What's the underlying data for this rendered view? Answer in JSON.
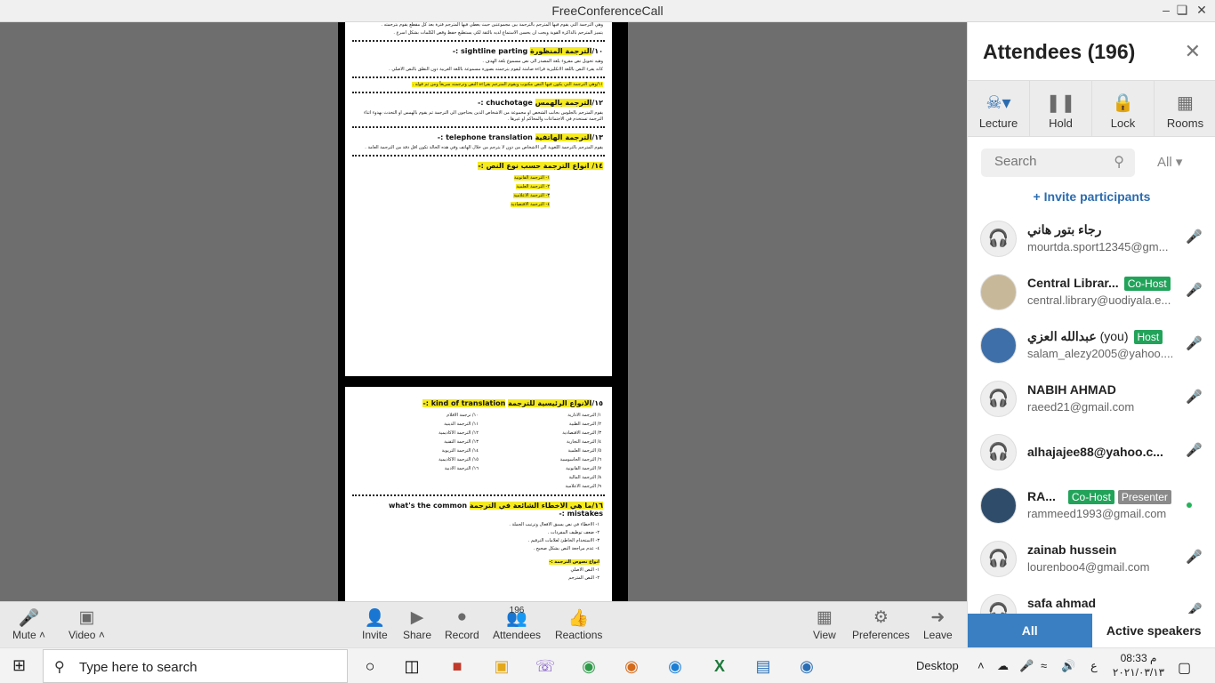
{
  "window": {
    "title": "FreeConferenceCall"
  },
  "document": {
    "page1": {
      "top_para_1": "وهي الترجمة التي يقوم فيها المترجم بالترجمة بين مجموعتين حيث يعطي فيها المترجم فترة بعد كل مقطع يقوم بترجمته .",
      "top_para_2": "يتميز المترجم بالذاكرة القوية ويجب ان يحسن الاستماع لديه بالثقة لكي يستطيع حفظ وقص الكلمات بشكل اسرع .",
      "h10_num": "١٠/",
      "h10_ar": "الترجمة المنظورة",
      "h10_en": "sightline parting :-",
      "p10_1": "وهيه تحويل نص مقروء بلغة المصدر الى نص مسموع بلغة الهدف .",
      "p10_2": "كانه يقرء النص باللغة الانكليزية قراءة صامتة ليقوم بترجمته بصورة مسموعة باللغة العربية دون النطق بالنص الاصلي .",
      "p11": "١١/وهي الترجمة التي يكون فيها النص مكتوب ويقوم المترجم بقراءة النص وترجمته سريعاً ومن ثم قوله .",
      "h12_num": "١٢/",
      "h12_ar": "الترجمة بالهمس",
      "h12_en": "chuchotage :-",
      "p12": "يقوم المترجم بالجلوس بجانب الشخص او مجموعة من الاشخاص الذين يحتاجون الى الترجمة ثم يقوم بالهمس او التحدث بهدوء اثناء الترجمة تستخدم في الاجتماعات والمحاكم او غيرها .",
      "h13_num": "١٣/",
      "h13_ar": "الترجمة الهاتفية",
      "h13_en": "telephone translation :-",
      "p13": "يقوم المترجم بالترجمة اللغوية الى الاشخاص من دون لا يترجم من خلال الهاتف وفي هذه الحالة تكون اقل دقة من الترجمة العامة .",
      "h14": "١٤/ انواع الترجمة حسب نوع النص :-",
      "list14": [
        "١- الترجمة القانونية",
        "٢- الترجمة العلمية",
        "٣- الترجمة الاعلامية",
        "٤- الترجمة الاقتصادية"
      ]
    },
    "page2": {
      "h15_num": "١٥/",
      "h15_ar": "الانواع الرئيسية للترجمة",
      "h15_en": "kind of translation :-",
      "col_right": [
        "١/ الترجمة الادارية",
        "٢/ الترجمة الطبية",
        "٣/ الترجمة الاقتصادية",
        "٤/ الترجمة التجارية",
        "٥/ الترجمة العلمية",
        "٦/ الترجمة الجاسوسية",
        "٧/ الترجمة القانونية",
        "٨/ الترجمة المالية",
        "٩/ الترجمة الاعلامية"
      ],
      "col_left": [
        "١٠/ ترجمة الافلام",
        "١١/ الترجمة الدينية",
        "١٢/ الترجمة الاكاديمية",
        "١٣/ الترجمة التقنية",
        "١٤/ الترجمة التربوية",
        "١٥/ الترجمة الاكاديمية",
        "١٦/ الترجمة الادبية"
      ],
      "h16_num": "١٦/",
      "h16_ar": "ما هي الاخطاء الشائعة في الترجمة",
      "h16_en": "what's the common mistakes :-",
      "list16": [
        "١- الاخطاء في نص يسبق الافعال وترتيب الجملة .",
        "٢- ضعف توظيف المفردات .",
        "٣- الاستخدام الخاطئ لعلامات الترقيم .",
        "٤- عدم مراجعة النص بشكل صحيح ."
      ],
      "h17": "انواع نصوص الترجمة :-",
      "list17": [
        "١- النص الاصلي",
        "٢- النص المترجم"
      ]
    }
  },
  "panel": {
    "title": "Attendees (196)",
    "tools": [
      {
        "label": "Lecture",
        "icon": "lecture-icon"
      },
      {
        "label": "Hold",
        "icon": "pause-icon"
      },
      {
        "label": "Lock",
        "icon": "lock-icon"
      },
      {
        "label": "Rooms",
        "icon": "grid-icon"
      }
    ],
    "search_placeholder": "Search",
    "filter_label": "All",
    "invite_label": "Invite participants",
    "attendees": [
      {
        "name": "رجاء بتور هاني",
        "email": "mourtda.sport12345@gm...",
        "badges": []
      },
      {
        "name": "Central Librar...",
        "email": "central.library@uodiyala.e...",
        "badges": [
          "Co-Host"
        ]
      },
      {
        "name": "عبدالله العزي",
        "you": "(you)",
        "email": "salam_alezy2005@yahoo....",
        "badges": [
          "Host"
        ]
      },
      {
        "name": "NABIH AHMAD",
        "email": "raeed21@gmail.com",
        "badges": []
      },
      {
        "name": "alhajajee88@yahoo.c...",
        "email": "",
        "badges": []
      },
      {
        "name": "RA...",
        "email": "rammeed1993@gmail.com",
        "badges": [
          "Co-Host",
          "Presenter"
        ]
      },
      {
        "name": "zainab hussein",
        "email": "lourenboo4@gmail.com",
        "badges": []
      },
      {
        "name": "safa ahmad",
        "email": "",
        "badges": []
      }
    ],
    "tab_all": "All",
    "tab_active": "Active speakers"
  },
  "bottombar": {
    "mute": "Mute",
    "video": "Video",
    "invite": "Invite",
    "share": "Share",
    "record": "Record",
    "attendees": "Attendees",
    "attendees_count": "196",
    "reactions": "Reactions",
    "view": "View",
    "preferences": "Preferences",
    "leave": "Leave"
  },
  "taskbar": {
    "search_placeholder": "Type here to search",
    "desktop_label": "Desktop",
    "lang": "ع",
    "time": "08:33 م",
    "date": "٢٠٢١/٠٣/١٣"
  },
  "colors": {
    "highlight": "#f5ea1f",
    "badge_green": "#22a35a",
    "tab_active": "#3a7fc2",
    "mute_red": "#e04848"
  }
}
